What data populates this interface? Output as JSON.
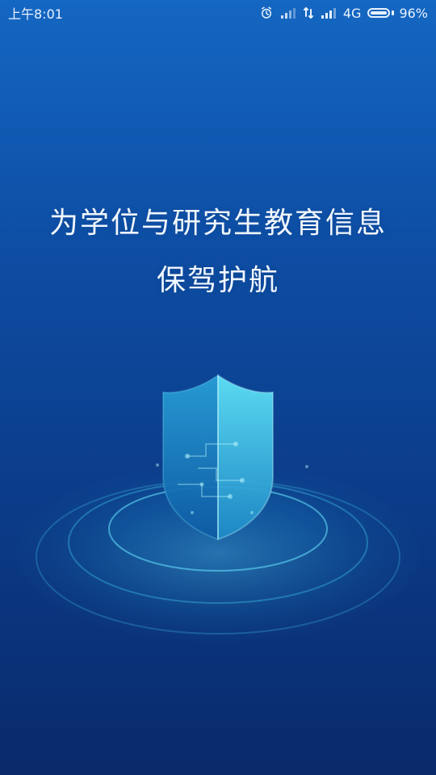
{
  "status_bar": {
    "time": "上午8:01",
    "network": "4G",
    "battery_percent_text": "96%",
    "battery_level": 0.96,
    "icons": [
      "alarm-icon",
      "signal-icon-1",
      "data-arrows-icon",
      "signal-icon-2",
      "battery-icon"
    ]
  },
  "headline": {
    "line1": "为学位与研究生教育信息",
    "line2": "保驾护航"
  },
  "colors": {
    "bg_top": "#1467c2",
    "bg_bottom": "#0a2a6b",
    "shield_left": "#1f86c7",
    "shield_right": "#41c8e3",
    "ring": "#46d4f1"
  },
  "hero": {
    "icon": "shield-icon"
  }
}
